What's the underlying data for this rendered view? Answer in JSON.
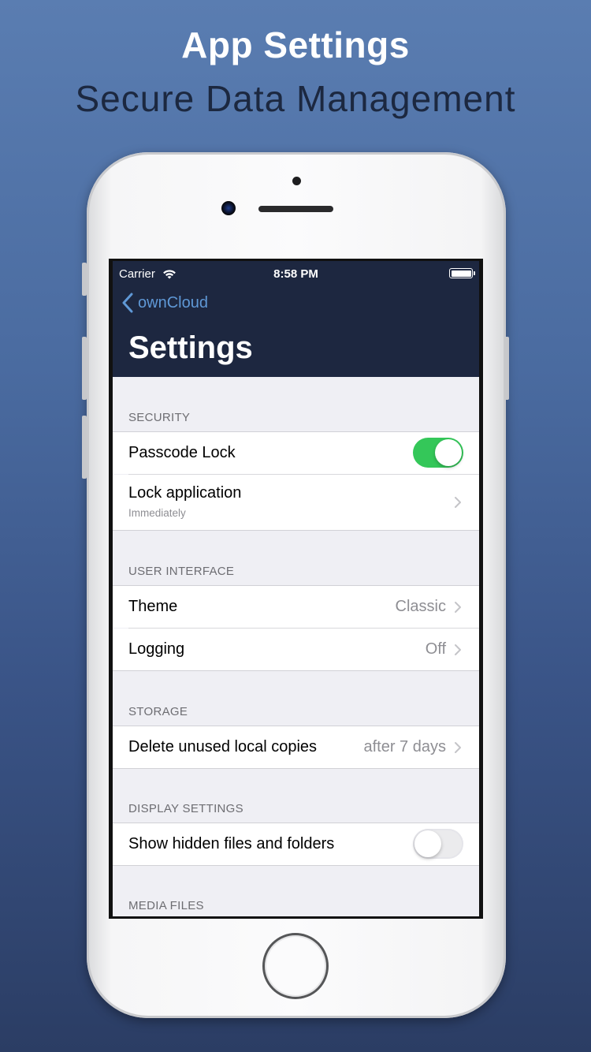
{
  "promo": {
    "headline": "App Settings",
    "subheadline": "Secure Data Management"
  },
  "status_bar": {
    "carrier": "Carrier",
    "time": "8:58 PM"
  },
  "navbar": {
    "back_label": "ownCloud",
    "title": "Settings",
    "color": "#1d2740",
    "accent": "#5f98d6"
  },
  "sections": {
    "security": {
      "header": "SECURITY",
      "passcode_lock": {
        "label": "Passcode Lock",
        "enabled": true
      },
      "lock_application": {
        "label": "Lock application",
        "subtitle": "Immediately"
      }
    },
    "user_interface": {
      "header": "USER INTERFACE",
      "theme": {
        "label": "Theme",
        "value": "Classic"
      },
      "logging": {
        "label": "Logging",
        "value": "Off"
      }
    },
    "storage": {
      "header": "STORAGE",
      "delete_unused": {
        "label": "Delete unused local copies",
        "value": "after 7 days"
      }
    },
    "display_settings": {
      "header": "DISPLAY SETTINGS",
      "show_hidden": {
        "label": "Show hidden files and folders",
        "enabled": false
      }
    },
    "media_files": {
      "header": "MEDIA FILES"
    }
  },
  "colors": {
    "toggle_on": "#34c759",
    "background": "#efeff4"
  }
}
